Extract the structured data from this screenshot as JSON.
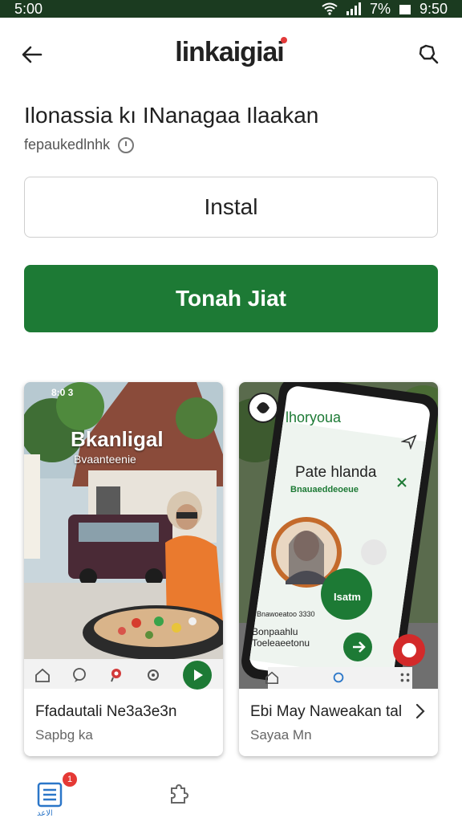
{
  "status_bar": {
    "time_left": "5:00",
    "battery": "7%",
    "time_right": "9:50"
  },
  "header": {
    "logo_text": "linkaigiai",
    "back_icon": "arrow-left-icon",
    "action_icon": "search-share-icon"
  },
  "app": {
    "title": "Ilonassia kı INanagaa Ilaakan",
    "subtitle": "fepaukedlnhk"
  },
  "buttons": {
    "install_label": "Instal",
    "primary_label": "Tonah Jiat"
  },
  "cards": [
    {
      "overlay_title": "Bkanligal",
      "overlay_sub": "Bvaanteenie",
      "label": "Ffadautali Ne3a3e3n",
      "sub": "Sapbg ka",
      "phone_status": "8:0 3"
    },
    {
      "app_name": "lhoryoua",
      "heading": "Pate hlanda",
      "sub_green": "Bnauaeddeoeue",
      "button": "Isatm",
      "caption": "Bnawoeatoo 3330",
      "meta1": "Bonpaahlu",
      "meta2": "Toeleaeetonu",
      "label": "Ebi May Naweakan tal",
      "sub": "Sayaa Mn"
    }
  ],
  "bottom_nav": {
    "caption": "الاعد",
    "badge": "1"
  },
  "colors": {
    "accent": "#1d7a35",
    "status_bar": "#1b3b20",
    "badge": "#e53935"
  }
}
